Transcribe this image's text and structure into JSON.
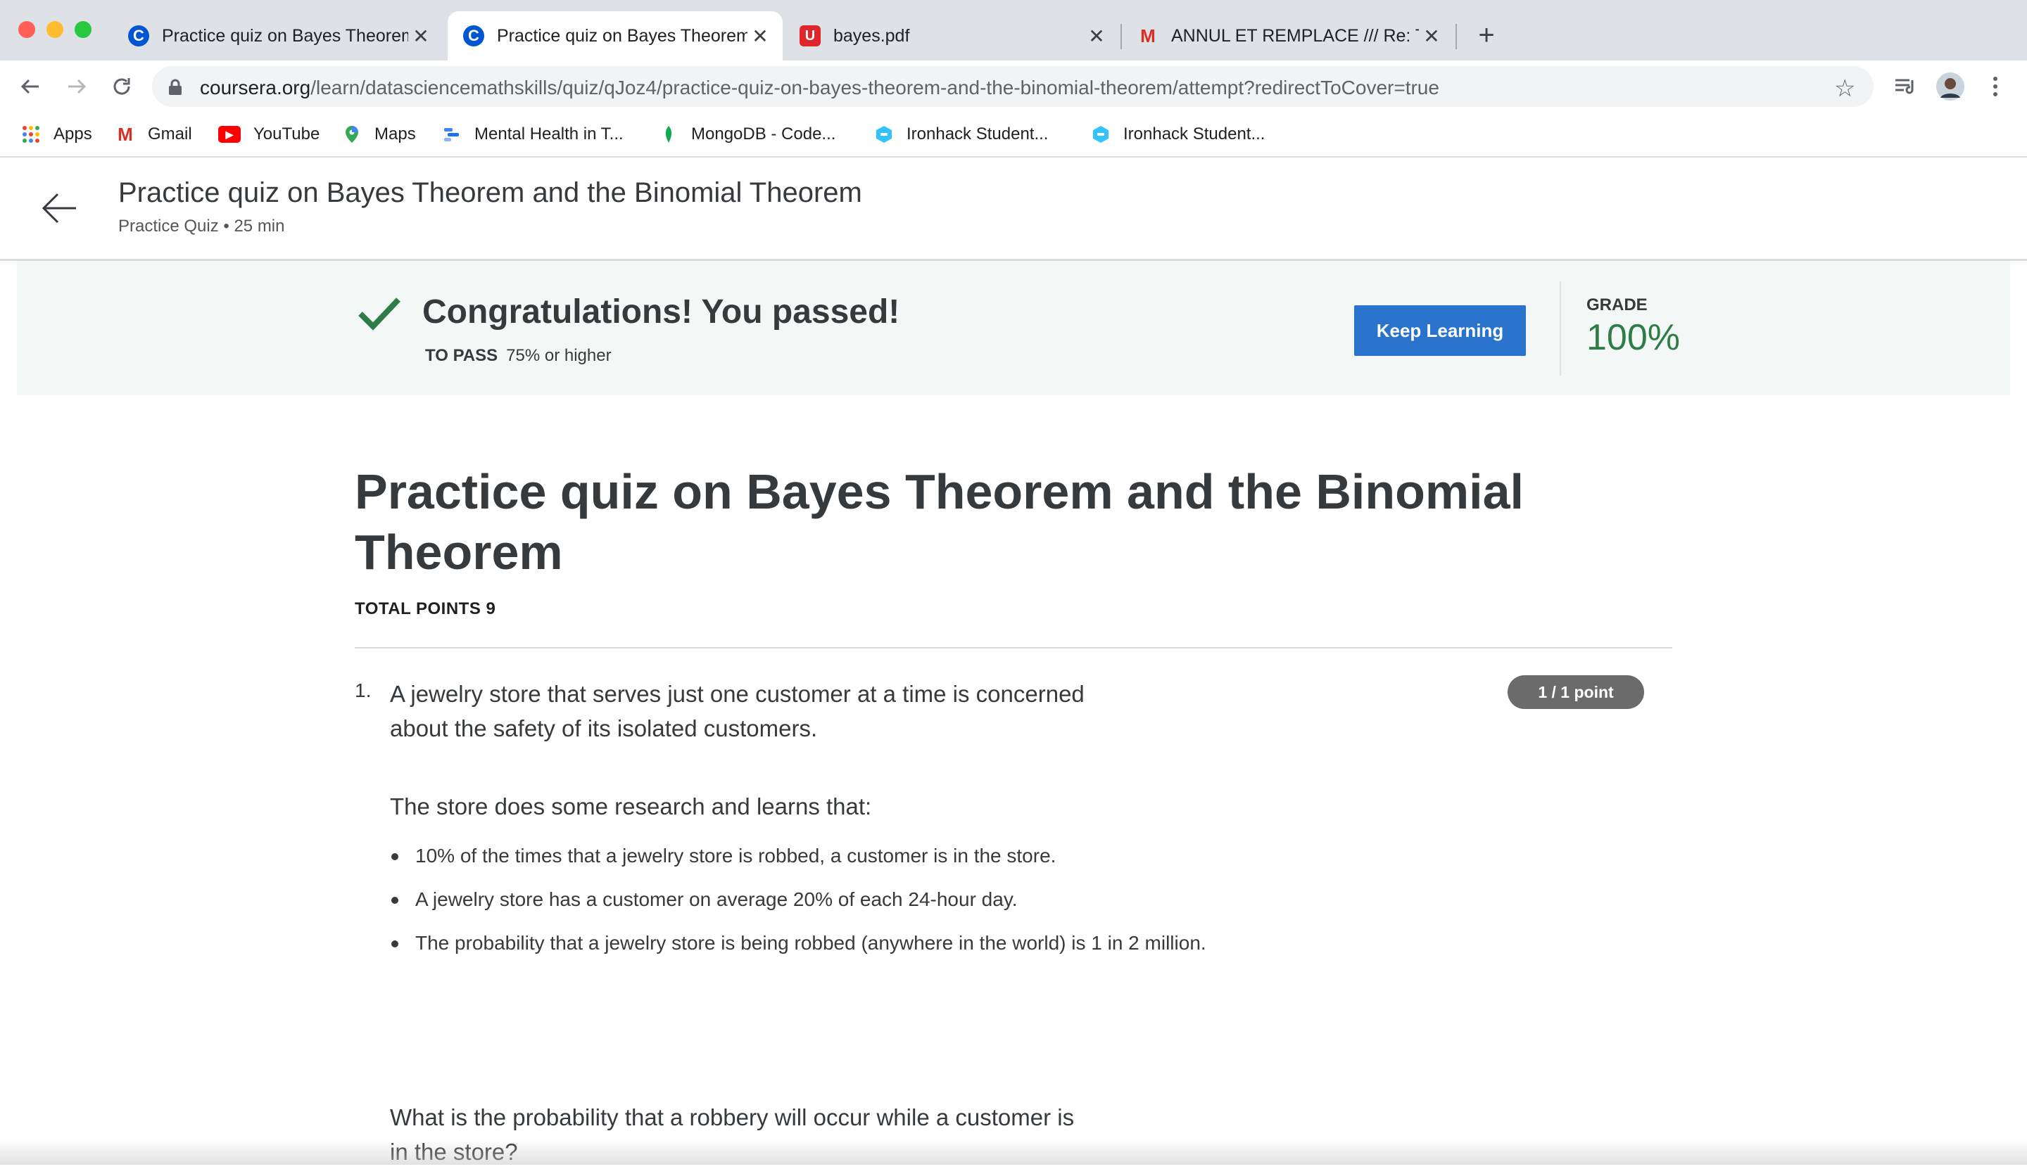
{
  "browser": {
    "tabs": [
      {
        "title": "Practice quiz on Bayes Theorem and the Binomial Theorem",
        "favicon": "coursera-icon",
        "active": false
      },
      {
        "title": "Practice quiz on Bayes Theorem and the Binomial Theorem",
        "favicon": "coursera-icon",
        "active": true
      },
      {
        "title": "bayes.pdf",
        "favicon": "pdf-icon",
        "active": false
      },
      {
        "title": "ANNUL ET REMPLACE /// Re: T",
        "favicon": "gmail-icon",
        "active": false
      }
    ],
    "url_domain": "coursera.org",
    "url_path": "/learn/datasciencemathskills/quiz/qJoz4/practice-quiz-on-bayes-theorem-and-the-binomial-theorem/attempt?redirectToCover=true",
    "bookmarks": [
      {
        "label": "Apps",
        "icon": "apps-grid-icon"
      },
      {
        "label": "Gmail",
        "icon": "gmail-icon"
      },
      {
        "label": "YouTube",
        "icon": "youtube-icon"
      },
      {
        "label": "Maps",
        "icon": "maps-pin-icon"
      },
      {
        "label": "Mental Health in T...",
        "icon": "bookmark-icon"
      },
      {
        "label": "MongoDB - Code...",
        "icon": "mongodb-leaf-icon"
      },
      {
        "label": "Ironhack Student...",
        "icon": "ironhack-icon"
      },
      {
        "label": "Ironhack Student...",
        "icon": "ironhack-icon"
      }
    ]
  },
  "header": {
    "title": "Practice quiz on Bayes Theorem and the Binomial Theorem",
    "subtitle": "Practice Quiz • 25 min"
  },
  "result": {
    "headline": "Congratulations! You passed!",
    "to_pass_label": "TO PASS",
    "to_pass_value": "75% or higher",
    "keep_learning": "Keep Learning",
    "grade_label": "GRADE",
    "grade_value": "100%"
  },
  "quiz": {
    "title": "Practice quiz on Bayes Theorem and the Binomial Theorem",
    "total_points": "TOTAL POINTS 9",
    "question": {
      "number": "1.",
      "points": "1 / 1 point",
      "text": "A jewelry store that serves just one customer at a time is concerned about the safety of its isolated customers.",
      "intro": "The store does some research and learns that:",
      "bullets": [
        "10% of the times that a jewelry store is robbed, a customer is in the store.",
        "A jewelry store has a customer on average 20% of each 24-hour day.",
        "The probability that a jewelry store is being robbed (anywhere in the world) is 1 in 2 million."
      ],
      "ask": "What is the probability that a robbery will occur while a customer is in the store?"
    }
  },
  "colors": {
    "coursera_blue": "#0056d2",
    "button_blue": "#2a73cc",
    "success_green": "#2e7d47",
    "banner_bg": "#f3f8f6"
  }
}
